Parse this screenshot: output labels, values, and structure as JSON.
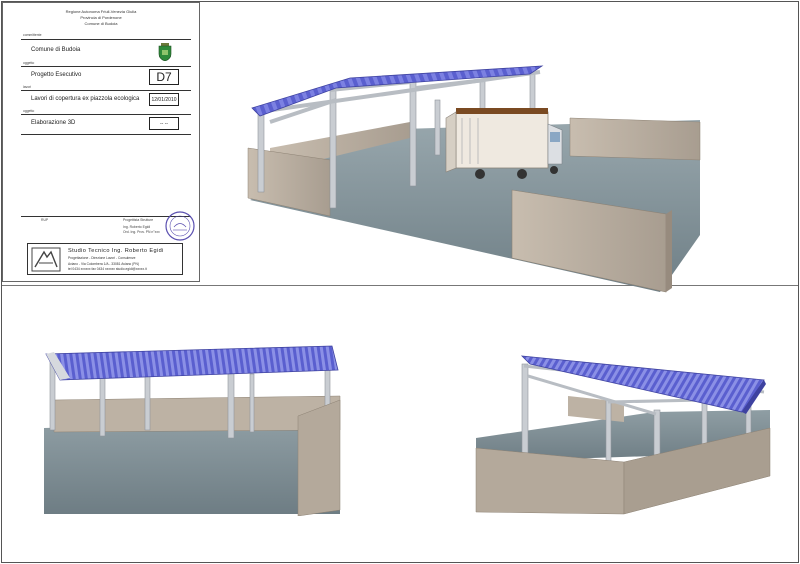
{
  "header": {
    "line1": "Regione Autonoma Friuli-Venezia Giulia",
    "line2": "Provincia di Pordenone",
    "line3": "Comune di Budoia"
  },
  "sections": {
    "committente_label": "committente",
    "oggetto_label": "oggetto",
    "lavori_label": "lavori",
    "oggetto2_label": "oggetto"
  },
  "client": "Comune di Budoia",
  "project_phase": "Progetto Esecutivo",
  "work_title": "Lavori di copertura ex piazzola ecologica",
  "drawing_title": "Elaborazione 3D",
  "drawing_code": "D7",
  "date": "12/01/2010",
  "revision": "-- --",
  "signatures": {
    "left_label": "RUP",
    "right_label": "Progettista Strutture",
    "engineer": "Ing. Roberto Egidi",
    "order": "Ord. Ing. Prov. PN n°xxx"
  },
  "studio": {
    "name": "Studio Tecnico Ing. Roberto Egidi",
    "services": "Progettazione - Direzione Lavori - Consulenze",
    "address": "Aviano - Via Colombera 1/A - 33081 Aviano (PN)",
    "contacts": "tel 0434 xxxxxx  fax 0434 xxxxxx  studio.egidi@xxxxx.it"
  },
  "colors": {
    "roof": "#5a5fcf",
    "roof_light": "#8b90e6",
    "steel": "#c9cdd2",
    "wall": "#b6ab9d",
    "floor": "#7e8e94",
    "truck_box": "#efe9e0",
    "truck_top": "#7a4a22"
  },
  "icons": {
    "crest": "municipal-crest-icon",
    "stamp": "engineer-stamp-icon",
    "logo": "studio-logo-icon"
  }
}
